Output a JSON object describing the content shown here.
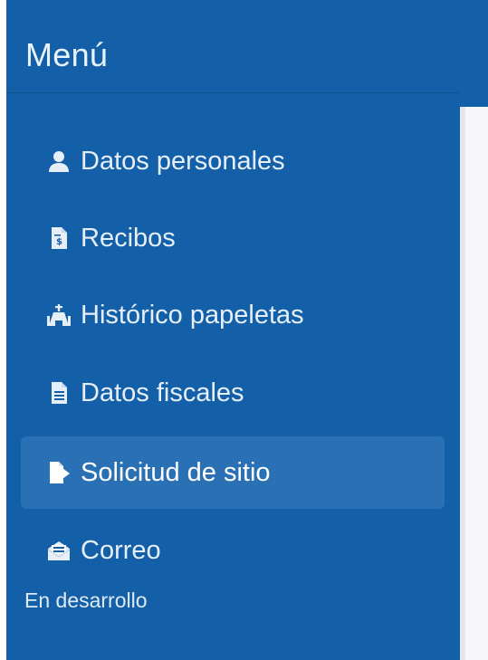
{
  "sidebar": {
    "title": "Menú",
    "items": [
      {
        "label": "Datos personales",
        "icon": "user-icon"
      },
      {
        "label": "Recibos",
        "icon": "receipt-icon"
      },
      {
        "label": "Histórico papeletas",
        "icon": "procession-icon"
      },
      {
        "label": "Datos fiscales",
        "icon": "document-icon"
      },
      {
        "label": "Solicitud de sitio",
        "icon": "file-export-icon",
        "active": true
      },
      {
        "label": "Correo",
        "icon": "envelope-open-icon"
      }
    ],
    "section_label": "En desarrollo"
  },
  "colors": {
    "sidebar_bg": "#1460a8",
    "active_bg": "#2a70b4",
    "text": "#e6eef8"
  }
}
